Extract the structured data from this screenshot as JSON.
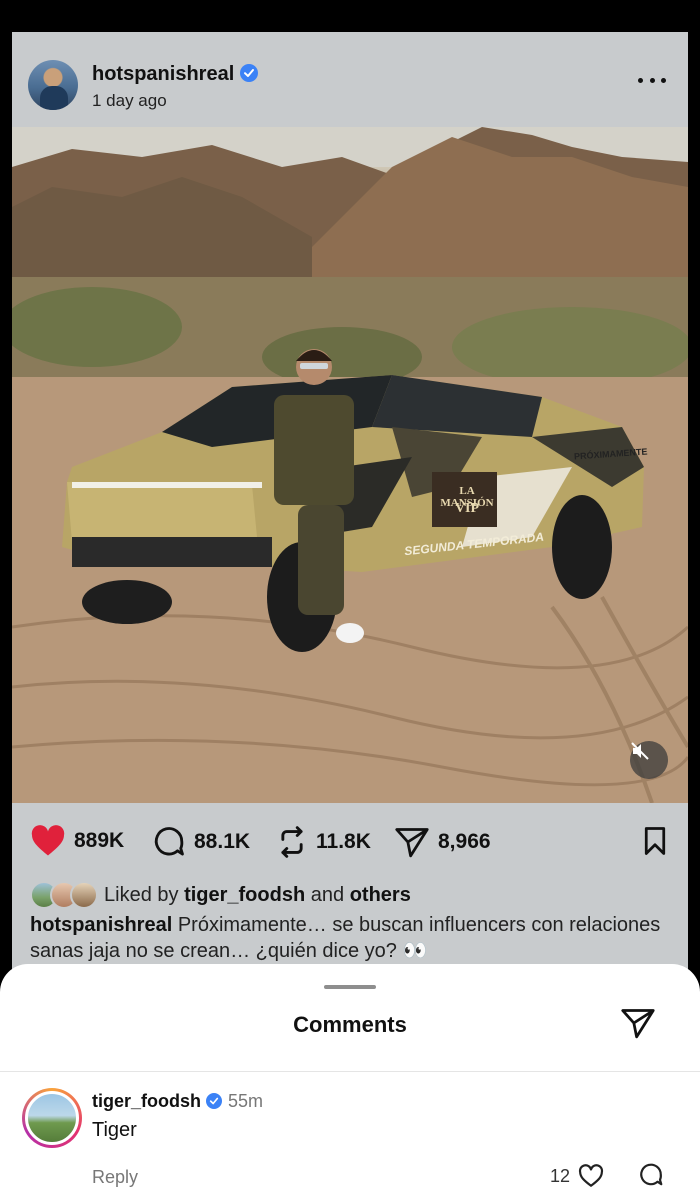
{
  "post": {
    "username": "hotspanishreal",
    "timestamp": "1 day ago",
    "image_text": {
      "brand_line1": "LA MANSIÓN",
      "brand_line2": "VIP",
      "season": "SEGUNDA TEMPORADA",
      "side": "PRÓXIMAMENTE"
    },
    "stats": {
      "likes": "889K",
      "comments": "88.1K",
      "reposts": "11.8K",
      "shares": "8,966"
    },
    "liked_by": {
      "prefix": "Liked by",
      "user": "tiger_foodsh",
      "middle": "and",
      "suffix": "others"
    },
    "caption": {
      "user": "hotspanishreal",
      "text": "Próximamente… se buscan influencers con relaciones sanas jaja no se crean… ¿quién dice yo? 👀"
    }
  },
  "comments_sheet": {
    "title": "Comments",
    "items": [
      {
        "user": "tiger_foodsh",
        "time": "55m",
        "text": "Tiger",
        "reply_label": "Reply",
        "likes": "12"
      }
    ]
  },
  "colors": {
    "like_red": "#e0213b",
    "verified_blue": "#3b82f6"
  },
  "icons": [
    "verified-badge-icon",
    "more-icon",
    "heart-icon",
    "comment-icon",
    "repost-icon",
    "share-icon",
    "bookmark-icon",
    "mute-icon"
  ]
}
